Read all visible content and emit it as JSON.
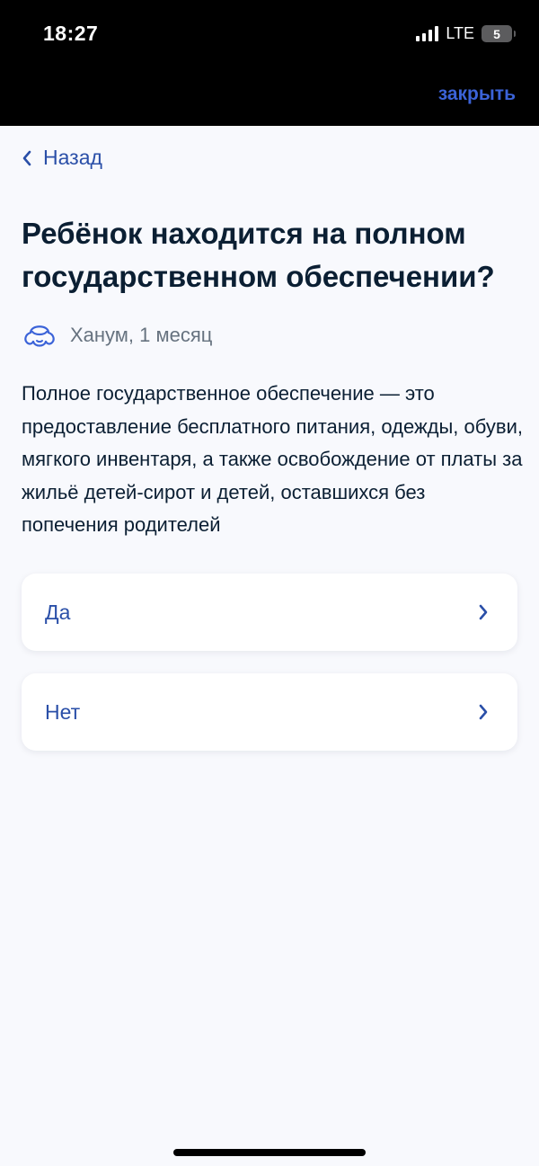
{
  "status_bar": {
    "time": "18:27",
    "network": "LTE",
    "battery_level": "5",
    "signal_icon": "signal-bars-icon"
  },
  "header": {
    "close_label": "закрыть"
  },
  "nav": {
    "back_label": "Назад",
    "back_icon": "chevron-left-icon"
  },
  "question": {
    "title": "Ребёнок находится на полном государственном обеспечении?",
    "child_icon": "child-face-icon",
    "child": "Ханум, 1 месяц",
    "description": "Полное государственное обеспечение — это предоставление бесплатного питания, одежды, обуви, мягкого инвентаря, а также освобождение от платы за жильё детей-сирот и детей, оставшихся без попечения родителей"
  },
  "options": [
    {
      "label": "Да",
      "icon": "chevron-right-icon"
    },
    {
      "label": "Нет",
      "icon": "chevron-right-icon"
    }
  ],
  "colors": {
    "accent": "#2a4fa8",
    "close_link": "#3b63d8",
    "text_primary": "#0b1f33",
    "text_secondary": "#66727f",
    "background": "#f8f9fd",
    "card": "#ffffff"
  }
}
